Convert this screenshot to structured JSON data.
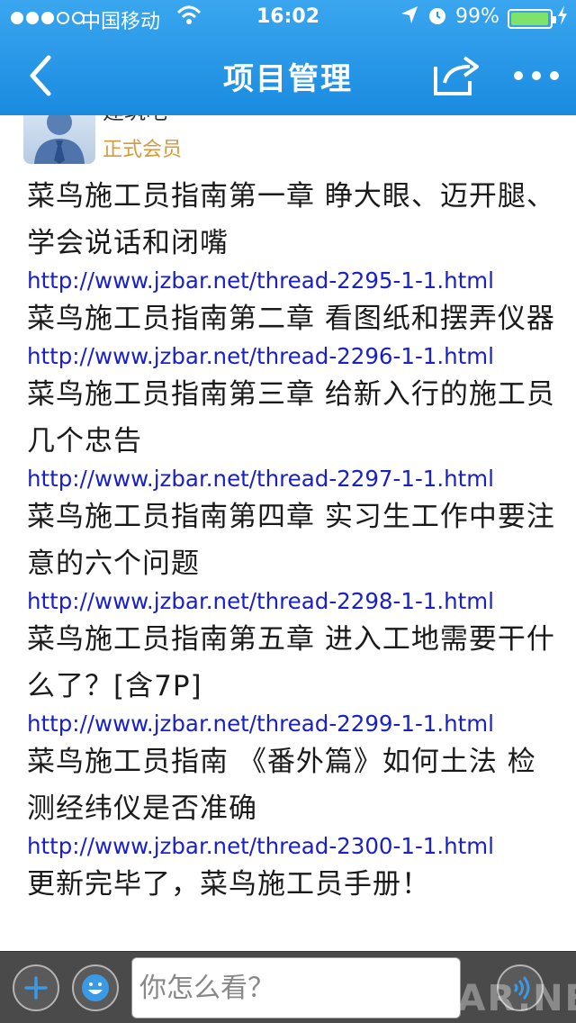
{
  "status_bar": {
    "carrier": "中国移动",
    "time": "16:02",
    "battery": "99%",
    "battery_level": 0.99,
    "signal_bars": 3,
    "icons": [
      "signal-icon",
      "wifi-icon",
      "location-icon",
      "alarm-icon",
      "battery-icon",
      "charging-icon"
    ]
  },
  "nav": {
    "title": "项目管理",
    "icons": [
      "back-icon",
      "share-icon",
      "more-icon"
    ]
  },
  "author": {
    "name": "建筑吧",
    "badge": "正式会员",
    "avatar_icon": "user-avatar-icon"
  },
  "post": {
    "entries": [
      {
        "title": "菜鸟施工员指南第一章 睁大眼、迈开腿、学会说话和闭嘴",
        "url": "http://www.jzbar.net/thread-2295-1-1.html"
      },
      {
        "title": "菜鸟施工员指南第二章 看图纸和摆弄仪器",
        "url": "http://www.jzbar.net/thread-2296-1-1.html"
      },
      {
        "title": "菜鸟施工员指南第三章 给新入行的施工员几个忠告",
        "url": "http://www.jzbar.net/thread-2297-1-1.html"
      },
      {
        "title": "菜鸟施工员指南第四章 实习生工作中要注意的六个问题",
        "url": "http://www.jzbar.net/thread-2298-1-1.html"
      },
      {
        "title": "菜鸟施工员指南第五章 进入工地需要干什么了？[含7P]",
        "url": "http://www.jzbar.net/thread-2299-1-1.html"
      },
      {
        "title": "菜鸟施工员指南 《番外篇》如何土法 检测经纬仪是否准确",
        "url": "http://www.jzbar.net/thread-2300-1-1.html"
      }
    ],
    "closing": "更新完毕了，菜鸟施工员手册！"
  },
  "composer": {
    "placeholder": "你怎么看？",
    "icons": [
      "plus-icon",
      "emoji-icon",
      "voice-icon"
    ]
  },
  "watermark": "JZBAR.NET",
  "colors": {
    "nav_bar": "#2196e8",
    "link": "#1a20c8",
    "badge": "#d59a3c",
    "bottom_bar": "#4a4a4a"
  }
}
